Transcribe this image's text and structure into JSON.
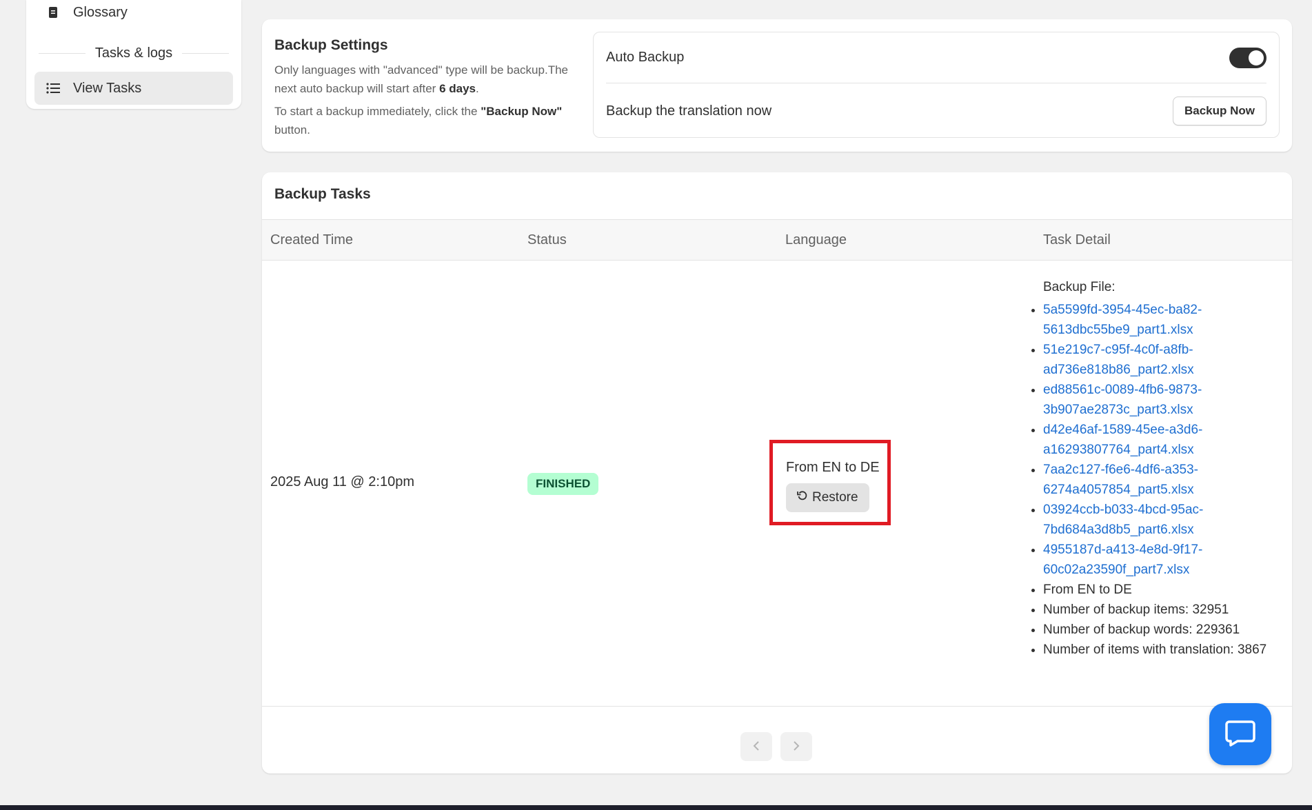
{
  "sidebar": {
    "glossary_label": "Glossary",
    "section_label": "Tasks & logs",
    "view_tasks_label": "View Tasks"
  },
  "settings": {
    "title": "Backup Settings",
    "desc_part1": "Only languages with \"advanced\" type will be backup.The next auto backup will start after ",
    "desc_bold": "6 days",
    "desc_end": ".",
    "desc2_part1": "To start a backup immediately, click the ",
    "desc2_bold": "\"Backup Now\"",
    "desc2_end": " button.",
    "auto_backup_label": "Auto Backup",
    "auto_backup_on": true,
    "backup_now_text": "Backup the translation now",
    "backup_now_button": "Backup Now"
  },
  "tasks": {
    "title": "Backup Tasks",
    "columns": [
      "Created Time",
      "Status",
      "Language",
      "Task Detail"
    ],
    "row": {
      "created_time": "2025 Aug 11 @ 2:10pm",
      "status": "FINISHED",
      "language": "From EN to DE",
      "restore_label": "Restore",
      "detail_heading": "Backup File:",
      "files": [
        "5a5599fd-3954-45ec-ba82-5613dbc55be9_part1.xlsx",
        "51e219c7-c95f-4c0f-a8fb-ad736e818b86_part2.xlsx",
        "ed88561c-0089-4fb6-9873-3b907ae2873c_part3.xlsx",
        "d42e46af-1589-45ee-a3d6-a16293807764_part4.xlsx",
        "7aa2c127-f6e6-4df6-a353-6274a4057854_part5.xlsx",
        "03924ccb-b033-4bcd-95ac-7bd684a3d8b5_part6.xlsx",
        "4955187d-a413-4e8d-9f17-60c02a23590f_part7.xlsx"
      ],
      "info": [
        "From EN to DE",
        "Number of backup items: 32951",
        "Number of backup words: 229361",
        "Number of items with translation: 3867"
      ]
    }
  },
  "colors": {
    "accent_link": "#1f6fd1",
    "status_badge_bg": "#b4fed2",
    "highlight_border": "#e01b24",
    "chat_button": "#1e7cf2"
  }
}
